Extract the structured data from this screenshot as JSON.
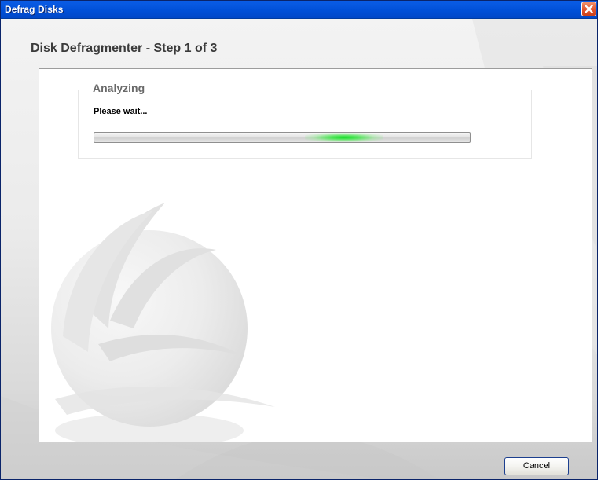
{
  "window": {
    "title": "Defrag Disks"
  },
  "header": {
    "step_title": "Disk Defragmenter - Step 1 of 3"
  },
  "analyzing": {
    "group_label": "Analyzing",
    "status": "Please wait...",
    "progress_mode": "indeterminate",
    "accent_color": "#22dd33"
  },
  "footer": {
    "cancel_label": "Cancel"
  },
  "icons": {
    "close": "close-icon",
    "logo": "logo-watermark-icon"
  },
  "colors": {
    "titlebar": "#0050d8",
    "close_button": "#e3572f",
    "progress_glow": "#22dd33"
  }
}
